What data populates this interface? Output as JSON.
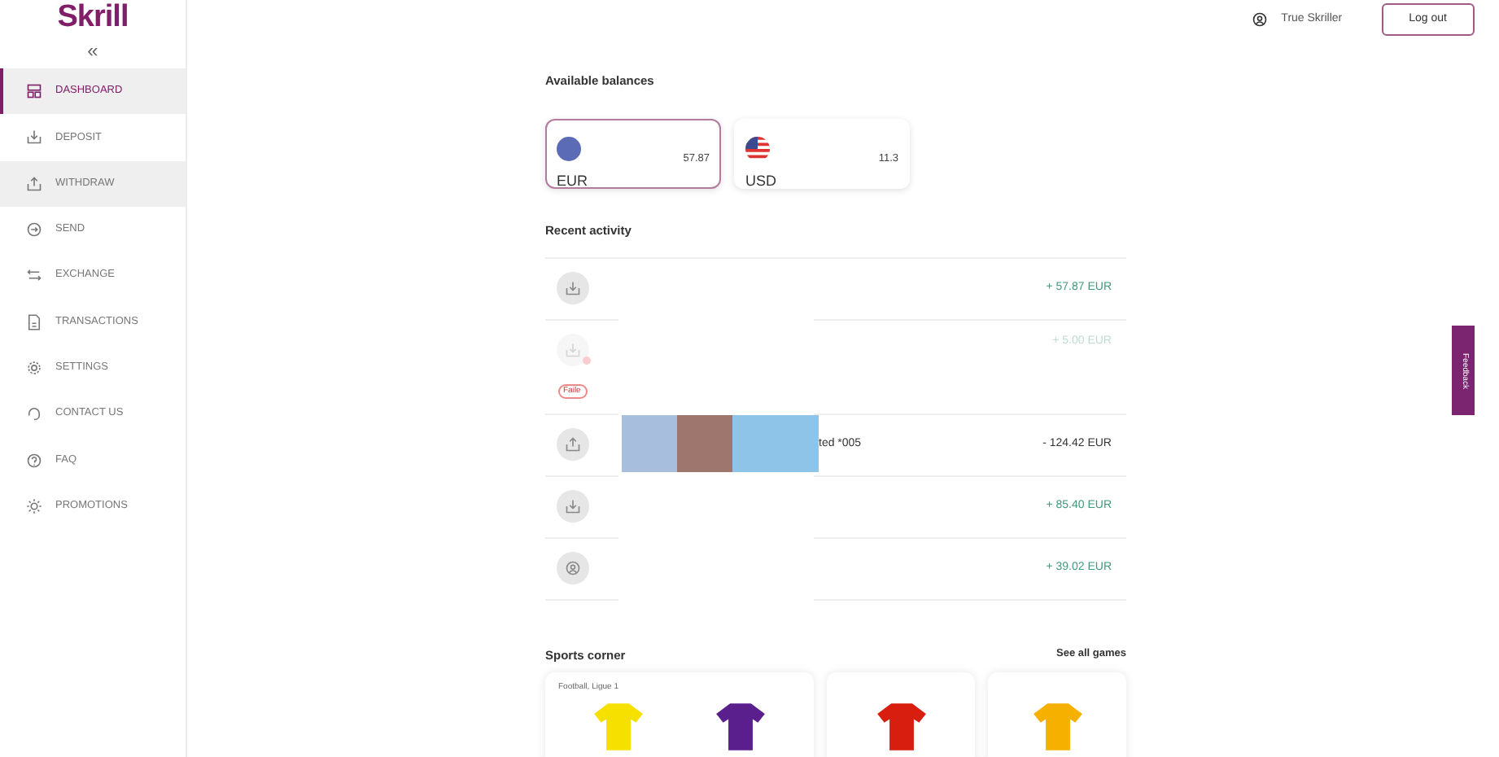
{
  "logo": "Skrill",
  "collapse": "«",
  "sidebar": {
    "items": [
      {
        "label": "DASHBOARD",
        "selected": true,
        "hovered": false
      },
      {
        "label": "DEPOSIT",
        "selected": false,
        "hovered": false
      },
      {
        "label": "WITHDRAW",
        "selected": false,
        "hovered": true
      },
      {
        "label": "SEND",
        "selected": false,
        "hovered": false
      },
      {
        "label": "EXCHANGE",
        "selected": false,
        "hovered": false
      },
      {
        "label": "TRANSACTIONS",
        "selected": false,
        "hovered": false
      },
      {
        "label": "SETTINGS",
        "selected": false,
        "hovered": false
      },
      {
        "label": "CONTACT US",
        "selected": false,
        "hovered": false
      },
      {
        "label": "FAQ",
        "selected": false,
        "hovered": false
      },
      {
        "label": "PROMOTIONS",
        "selected": false,
        "hovered": false
      }
    ]
  },
  "header": {
    "user_name": "True Skriller",
    "logout": "Log out"
  },
  "balances": {
    "title": "Available balances",
    "items": [
      {
        "currency": "EUR",
        "amount": "57.87",
        "selected": true
      },
      {
        "currency": "USD",
        "amount": "11.3",
        "selected": false
      }
    ]
  },
  "activity": {
    "title": "Recent activity",
    "rows": [
      {
        "kind": "credit",
        "failed": false,
        "amount": "+ 57.87 EUR"
      },
      {
        "kind": "credit",
        "failed": true,
        "badge": "Faile",
        "amount": "+ 5.00 EUR"
      },
      {
        "kind": "debit",
        "failed": false,
        "description": "ted *005",
        "amount": "- 124.42 EUR"
      },
      {
        "kind": "credit",
        "failed": false,
        "amount": "+ 85.40 EUR"
      },
      {
        "kind": "credit",
        "failed": false,
        "amount": "+ 39.02 EUR"
      }
    ]
  },
  "sports": {
    "title": "Sports corner",
    "link": "See all games",
    "cards": [
      {
        "league": "Football, Ligue 1",
        "shirts": [
          {
            "color": "#f5e000"
          },
          {
            "color": "#5a1f8c"
          }
        ]
      },
      {
        "shirts": [
          {
            "color": "#d81e0e"
          }
        ]
      },
      {
        "shirts": [
          {
            "color": "#f5b000"
          }
        ]
      }
    ]
  },
  "feedback": "Feedback"
}
